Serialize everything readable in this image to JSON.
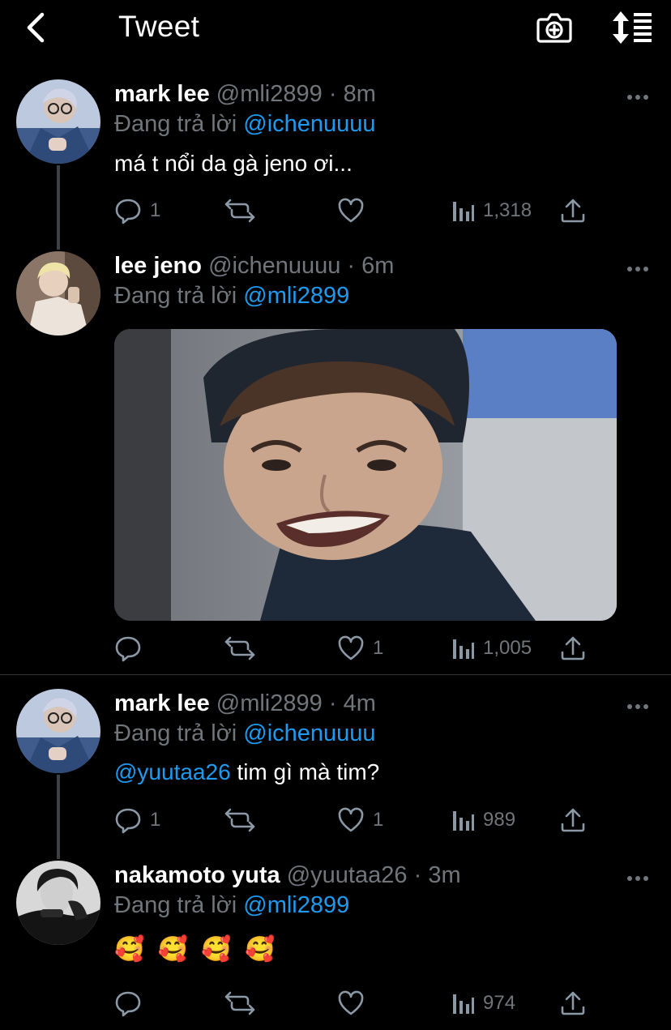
{
  "header": {
    "title": "Tweet"
  },
  "tweets": [
    {
      "name": "mark lee",
      "handle": "@mli2899",
      "time": "8m",
      "reply_prefix": "Đang trả lời",
      "reply_to": "@ichenuuuu",
      "text": "má t nổi da gà jeno ơi...",
      "replies": "1",
      "likes": "",
      "views": "1,318"
    },
    {
      "name": "lee jeno",
      "handle": "@ichenuuuu",
      "time": "6m",
      "reply_prefix": "Đang trả lời",
      "reply_to": "@mli2899",
      "text": "",
      "replies": "",
      "likes": "1",
      "views": "1,005"
    },
    {
      "name": "mark lee",
      "handle": "@mli2899",
      "time": "4m",
      "reply_prefix": "Đang trả lời",
      "reply_to": "@ichenuuuu",
      "text_mention": "@yuutaa26",
      "text": "tim gì mà tim?",
      "replies": "1",
      "likes": "1",
      "views": "989"
    },
    {
      "name": "nakamoto yuta",
      "handle": "@yuutaa26",
      "time": "3m",
      "reply_prefix": "Đang trả lời",
      "reply_to": "@mli2899",
      "text": "🥰 🥰 🥰 🥰",
      "replies": "",
      "likes": "",
      "views": "974"
    }
  ],
  "separator_dot": "·",
  "colors": {
    "background": "#000000",
    "accent": "#1d9bf0",
    "muted": "#71767b"
  }
}
